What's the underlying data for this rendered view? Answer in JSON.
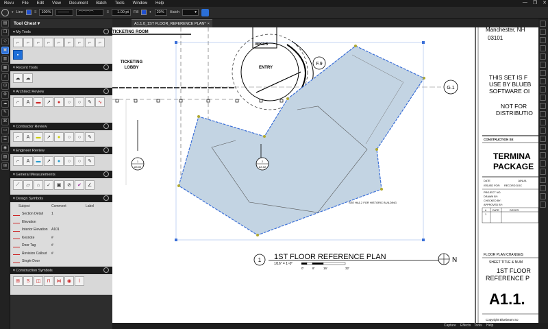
{
  "menubar": {
    "items": [
      "Revu",
      "File",
      "Edit",
      "View",
      "Document",
      "Batch",
      "Tools",
      "Window",
      "Help"
    ],
    "window_controls": [
      "—",
      "❐",
      "✕"
    ]
  },
  "toolbar": {
    "line_label": "Line",
    "line_width": "100%",
    "stroke_width": "1.00 pt",
    "fill_label": "Fill",
    "opacity": "20%",
    "hatch_label": "Hatch",
    "line_color": "#1f4fd0",
    "fill_color": "#1f4fd0"
  },
  "panel": {
    "title": "Tool Chest",
    "sections": {
      "my_tools": "My Tools",
      "recent_tools": "Recent Tools",
      "architect_review": "Architect Review",
      "contractor_review": "Contractor Review",
      "engineer_review": "Engineer Review",
      "general_measurements": "General Measurements",
      "design_symbols": "Design Symbols",
      "construction_symbols": "Construction Symbols"
    },
    "design_symbols": {
      "headers": [
        "Subject",
        "Comment",
        "Label"
      ],
      "rows": [
        {
          "subject": "Section Detail",
          "comment": "1"
        },
        {
          "subject": "Elevation",
          "comment": ""
        },
        {
          "subject": "Interior Elevation",
          "comment": "A101"
        },
        {
          "subject": "Keynote",
          "comment": "#"
        },
        {
          "subject": "Door Tag",
          "comment": "#"
        },
        {
          "subject": "Revision Callout",
          "comment": "#"
        },
        {
          "subject": "Single Door",
          "comment": ""
        }
      ]
    }
  },
  "tab": {
    "label": "A1.1.0_1ST FLOOR_REFERENCE PLAN*",
    "close": "×"
  },
  "drawing": {
    "room_ticketing": "TICKETING ROOM",
    "room_lobby_1": "TICKETING",
    "room_lobby_2": "LOBBY",
    "room_bikes": "BIKES",
    "room_entry": "ENTRY",
    "grid_f9": "F.9",
    "grid_g1": "G.1",
    "section_num": "1",
    "section_sheet": "A3.02",
    "section2_num": "2",
    "section2_sheet": "A3.02",
    "note": "SEE HA1.2 FOR HISTORIC BUILDING",
    "plan_number": "1",
    "plan_title": "1ST FLOOR REFERENCE PLAN",
    "plan_scale": "1/16\" = 1'-0\"",
    "scale_ticks": [
      "0'",
      "8'",
      "16'",
      "32'"
    ],
    "north": "N"
  },
  "titleblock": {
    "address": "Manchester, NH",
    "zip": "03101",
    "disclaimer_lines": [
      "THIS SET IS F",
      "USE BY BLUEB",
      "SOFTWARE OI",
      "",
      "NOT FOR",
      "DISTRIBUTIO"
    ],
    "construction_set": "CONSTRUCTION SE",
    "project_1": "TERMINA",
    "project_2": "PACKAGE",
    "date_label": "DATE",
    "date_value": "JANUA",
    "issued_label": "ISSUED FOR:",
    "issued_value": "RECORD DOC",
    "project_no": "PROJECT NO.",
    "drawn_by": "DRAWN BY:",
    "checked_by": "CHECKED BY:",
    "approved_by": "APPROVED BY:",
    "rev_headers": [
      "#",
      "DATE",
      "DESCR"
    ],
    "rev_first": "1",
    "changes": "FLOOR PLAN CHANGES",
    "sheet_title_label": "SHEET TITLE & NUM",
    "sheet_title_1": "1ST FLOOR",
    "sheet_title_2": "REFERENCE P",
    "sheet_number": "A1.1.",
    "copyright": "Copyright Bluebeam So"
  },
  "statusbar": {
    "items": [
      "Capture",
      "Effects",
      "Tools",
      "Help"
    ]
  },
  "markup": {
    "fill": "#c3d4e3",
    "stroke": "#3a6fd8",
    "vertex_color": "#b0a830"
  }
}
